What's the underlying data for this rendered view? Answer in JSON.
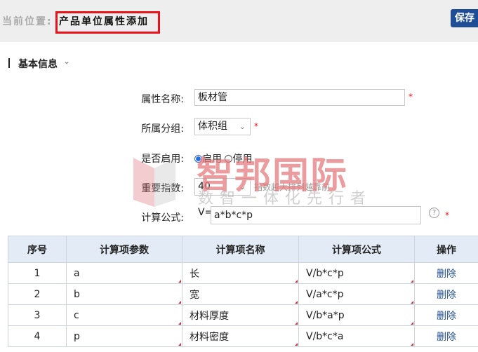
{
  "header": {
    "breadcrumb_label": "当前位置:",
    "page_title": "产品单位属性添加",
    "save_label": "保存",
    "accent": "#1f4e96",
    "highlight": "#e8131b"
  },
  "section": {
    "title": "基本信息",
    "chevron_icon": "chevron-down-icon"
  },
  "form": {
    "name_label": "属性名称:",
    "name_value": "板材管",
    "group_label": "所属分组:",
    "group_value": "体积组",
    "enabled_label": "是否启用:",
    "enabled_on": "启用",
    "enabled_off": "停用",
    "enabled_selected": "启用",
    "importance_label": "重要指数:",
    "importance_value": "40",
    "importance_hint": "指数越大排列越靠前",
    "formula_label": "计算公式:",
    "formula_prefix": "V=",
    "formula_value": "a*b*c*p",
    "required_mark": "*",
    "help_icon": "?"
  },
  "table": {
    "headers": [
      "序号",
      "计算项参数",
      "计算项名称",
      "计算项公式",
      "操作"
    ],
    "rows": [
      {
        "no": "1",
        "param": "a",
        "name": "长",
        "formula": "V/b*c*p",
        "action": "删除"
      },
      {
        "no": "2",
        "param": "b",
        "name": "宽",
        "formula": "V/a*c*p",
        "action": "删除"
      },
      {
        "no": "3",
        "param": "c",
        "name": "材料厚度",
        "formula": "V/b*a*p",
        "action": "删除"
      },
      {
        "no": "4",
        "param": "p",
        "name": "材料密度",
        "formula": "V/b*c*a",
        "action": "删除"
      }
    ]
  },
  "watermark": {
    "main": "智邦国际",
    "sub": "数智一体化先行者"
  }
}
